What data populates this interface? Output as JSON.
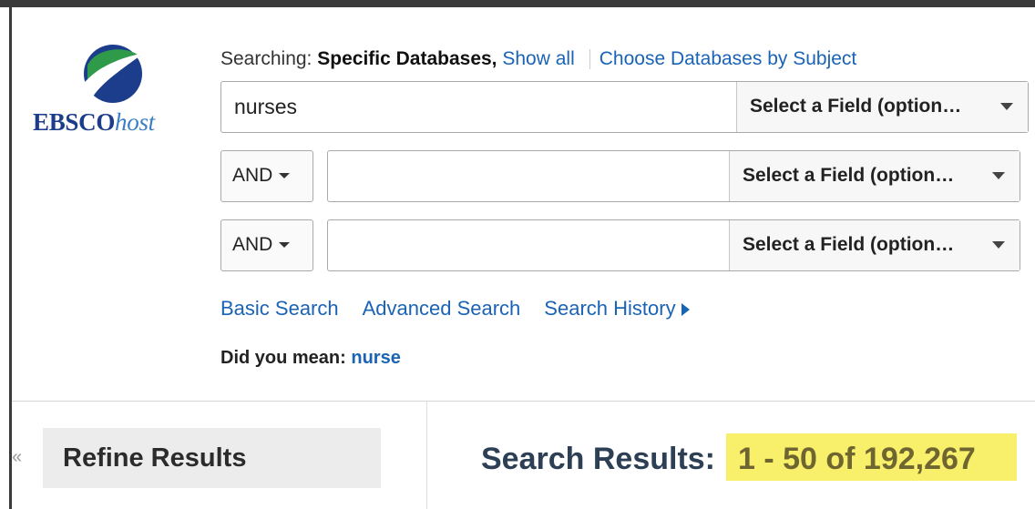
{
  "logo": {
    "brand": "EBSCO",
    "suffix": "host",
    "colors": {
      "green": "#2e9a4a",
      "blue": "#1c3d8c"
    }
  },
  "searching": {
    "label": "Searching:",
    "databases": "Specific Databases,",
    "show_all": "Show all",
    "choose_by_subject": "Choose Databases by Subject"
  },
  "search_rows": [
    {
      "operator": null,
      "value": "nurses",
      "field": "Select a Field (option…"
    },
    {
      "operator": "AND",
      "value": "",
      "field": "Select a Field (option…"
    },
    {
      "operator": "AND",
      "value": "",
      "field": "Select a Field (option…"
    }
  ],
  "links": {
    "basic": "Basic Search",
    "advanced": "Advanced Search",
    "history": "Search History"
  },
  "did_you_mean": {
    "label": "Did you mean:",
    "suggestion": "nurse"
  },
  "refine": {
    "title": "Refine Results",
    "collapse": "«"
  },
  "results": {
    "label": "Search Results:",
    "count": "1 - 50 of 192,267",
    "highlight_color": "#f8ef6b"
  }
}
